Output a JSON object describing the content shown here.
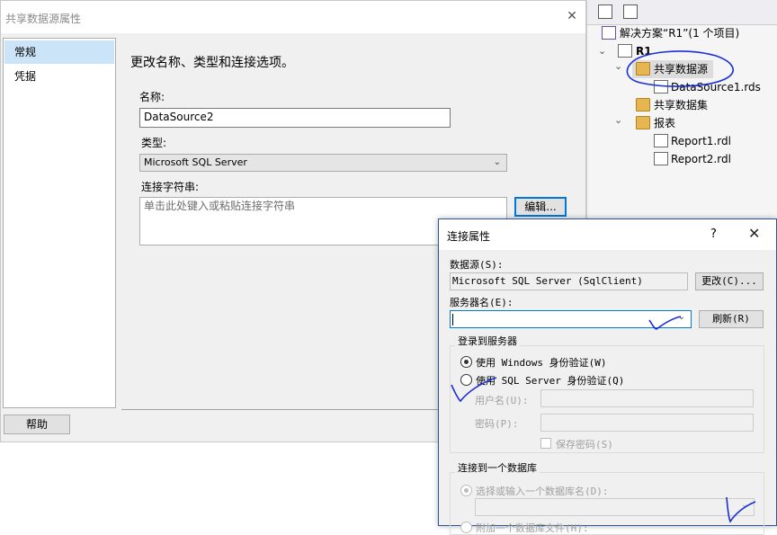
{
  "dialog": {
    "title": "共享数据源属性",
    "close_glyph": "✕",
    "nav": [
      {
        "label": "常规"
      },
      {
        "label": "凭据"
      }
    ],
    "heading": "更改名称、类型和连接选项。",
    "name_label": "名称:",
    "name_value": "DataSource2",
    "type_label": "类型:",
    "type_value": "Microsoft SQL Server",
    "conn_label": "连接字符串:",
    "conn_placeholder": "单击此处键入或粘贴连接字符串",
    "edit_button": "编辑...",
    "help_button": "帮助"
  },
  "solution_explorer": {
    "solution": "解决方案“R1”(1 个项目)",
    "project": "R1",
    "items": [
      {
        "label": "共享数据源",
        "icon": "folder-open-icon"
      },
      {
        "label": "DataSource1.rds",
        "icon": "data-source-file-icon"
      },
      {
        "label": "共享数据集",
        "icon": "folder-icon"
      },
      {
        "label": "报表",
        "icon": "folder-open-icon"
      },
      {
        "label": "Report1.rdl",
        "icon": "report-file-icon"
      },
      {
        "label": "Report2.rdl",
        "icon": "report-file-icon"
      }
    ]
  },
  "connection": {
    "title": "连接属性",
    "help_glyph": "?",
    "close_glyph": "✕",
    "datasource_label": "数据源(S):",
    "datasource_value": "Microsoft SQL Server (SqlClient)",
    "change_button": "更改(C)...",
    "server_label": "服务器名(E):",
    "server_value": "",
    "refresh_button": "刷新(R)",
    "login_group": "登录到服务器",
    "auth_windows": "使用 Windows 身份验证(W)",
    "auth_sql": "使用 SQL Server 身份验证(Q)",
    "username_label": "用户名(U):",
    "password_label": "密码(P):",
    "save_password": "保存密码(S)",
    "db_group": "连接到一个数据库",
    "db_select": "选择或输入一个数据库名(D):",
    "db_attach": "附加一个数据库文件(H):"
  },
  "colors": {
    "selection": "#cce4f7",
    "ink": "#1a2fd6",
    "focus_border": "#0078d7"
  }
}
